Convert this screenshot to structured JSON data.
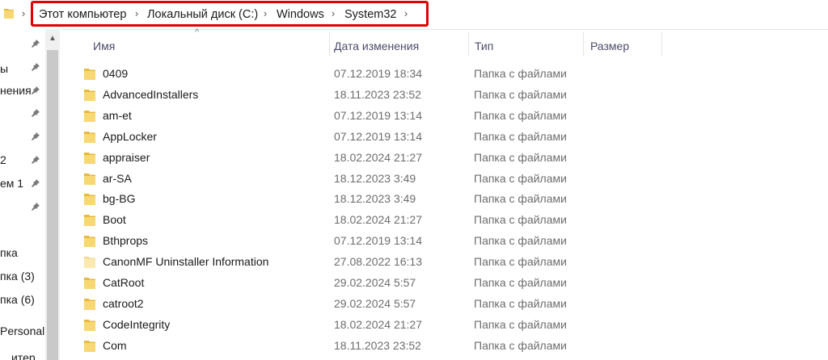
{
  "address_bar": {
    "crumbs": [
      "Этот компьютер",
      "Локальный диск (C:)",
      "Windows",
      "System32"
    ]
  },
  "nav": {
    "items": [
      "ы",
      "нения",
      "",
      "",
      "2",
      "ем 1",
      "",
      "",
      "пка",
      "пка (3)",
      "пка (6)",
      "Personal",
      "…итер"
    ]
  },
  "columns": {
    "name": "Имя",
    "date": "Дата изменения",
    "type": "Тип",
    "size": "Размер"
  },
  "files": [
    {
      "name": "0409",
      "date": "07.12.2019 18:34",
      "type": "Папка с файлами"
    },
    {
      "name": "AdvancedInstallers",
      "date": "18.11.2023 23:52",
      "type": "Папка с файлами"
    },
    {
      "name": "am-et",
      "date": "07.12.2019 13:14",
      "type": "Папка с файлами"
    },
    {
      "name": "AppLocker",
      "date": "07.12.2019 13:14",
      "type": "Папка с файлами"
    },
    {
      "name": "appraiser",
      "date": "18.02.2024 21:27",
      "type": "Папка с файлами"
    },
    {
      "name": "ar-SA",
      "date": "18.12.2023 3:49",
      "type": "Папка с файлами"
    },
    {
      "name": "bg-BG",
      "date": "18.12.2023 3:49",
      "type": "Папка с файлами"
    },
    {
      "name": "Boot",
      "date": "18.02.2024 21:27",
      "type": "Папка с файлами"
    },
    {
      "name": "Bthprops",
      "date": "07.12.2019 13:14",
      "type": "Папка с файлами"
    },
    {
      "name": "CanonMF Uninstaller Information",
      "date": "27.08.2022 16:13",
      "type": "Папка с файлами"
    },
    {
      "name": "CatRoot",
      "date": "29.02.2024 5:57",
      "type": "Папка с файлами"
    },
    {
      "name": "catroot2",
      "date": "29.02.2024 5:57",
      "type": "Папка с файлами"
    },
    {
      "name": "CodeIntegrity",
      "date": "18.02.2024 21:27",
      "type": "Папка с файлами"
    },
    {
      "name": "Com",
      "date": "18.11.2023 23:52",
      "type": "Папка с файлами"
    }
  ],
  "colors": {
    "folder": "#f8d775",
    "folder_light": "#fbe9b0",
    "highlight": "#e10000"
  },
  "icons": {
    "folder": "folder-icon",
    "pin": "pin-icon",
    "chevron": "chevron-right-icon"
  }
}
